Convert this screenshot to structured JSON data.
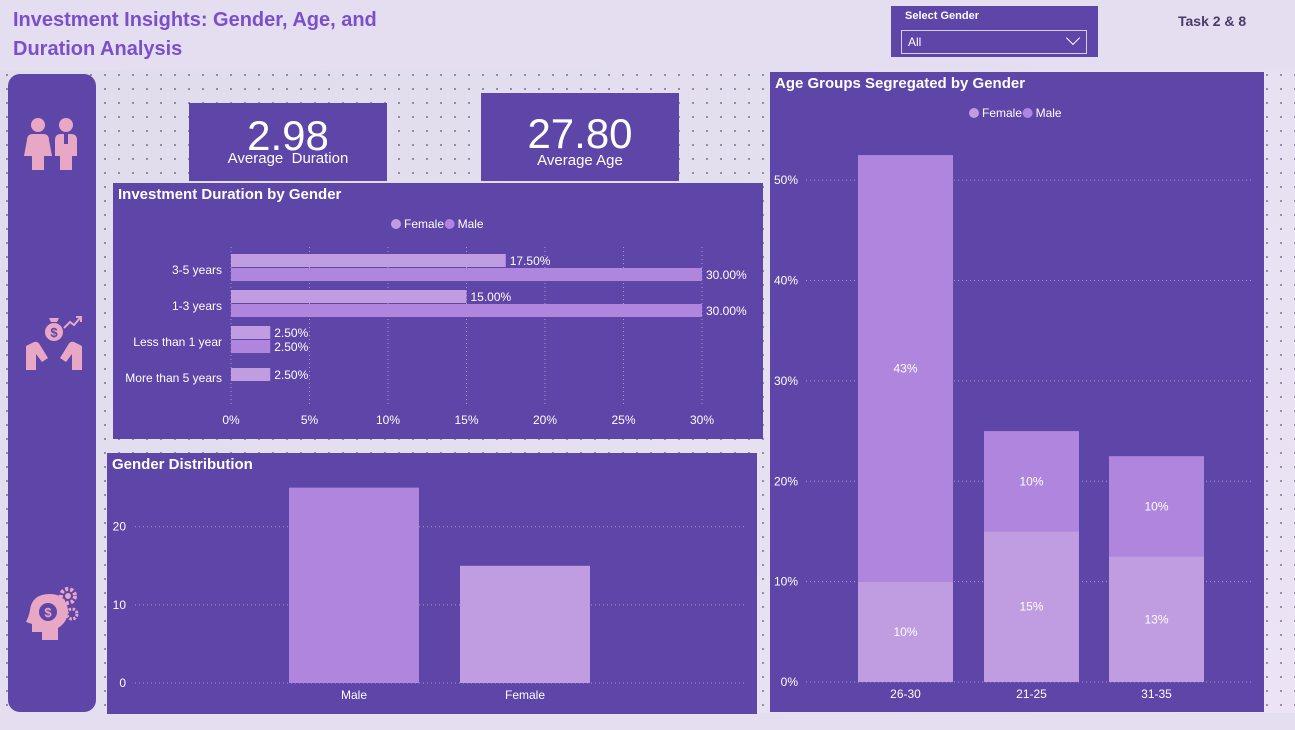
{
  "header": {
    "title": "Investment Insights: Gender, Age, and Duration Analysis",
    "task": "Task 2 & 8"
  },
  "slicer": {
    "label": "Select Gender",
    "value": "All"
  },
  "sidebar": {
    "icons": [
      "people-icon",
      "money-growth-hands-icon",
      "finance-mind-gears-icon"
    ],
    "icon_color": "#e8a7c4"
  },
  "kpis": {
    "duration": {
      "value": "2.98",
      "label": "Average  Duration"
    },
    "age": {
      "value": "27.80",
      "label": "Average Age"
    }
  },
  "colors": {
    "panel": "#5e45a8",
    "female": "#c09de0",
    "male": "#b085de",
    "title": "#7b4fc9"
  },
  "chart_data": [
    {
      "id": "duration",
      "type": "bar",
      "orientation": "horizontal",
      "title": "Investment Duration by Gender",
      "legend": [
        "Female",
        "Male"
      ],
      "legend_position": "top-center",
      "categories": [
        "3-5 years",
        "1-3 years",
        "Less than 1 year",
        "More than 5 years"
      ],
      "series": [
        {
          "name": "Female",
          "values": [
            17.5,
            15.0,
            2.5,
            2.5
          ],
          "labels": [
            "17.50%",
            "15.00%",
            "2.50%",
            "2.50%"
          ]
        },
        {
          "name": "Male",
          "values": [
            30.0,
            30.0,
            2.5,
            null
          ],
          "labels": [
            "30.00%",
            "30.00%",
            "2.50%",
            ""
          ]
        }
      ],
      "xlim": [
        0,
        30
      ],
      "xticks": [
        "0%",
        "5%",
        "10%",
        "15%",
        "20%",
        "25%",
        "30%"
      ],
      "xtick_values": [
        0,
        5,
        10,
        15,
        20,
        25,
        30
      ],
      "grid": true
    },
    {
      "id": "gender",
      "type": "bar",
      "title": "Gender Distribution",
      "categories": [
        "Male",
        "Female"
      ],
      "values": [
        25,
        15
      ],
      "ylim": [
        0,
        27
      ],
      "yticks": [
        "0",
        "10",
        "20"
      ],
      "ytick_values": [
        0,
        10,
        20
      ],
      "grid": true
    },
    {
      "id": "age",
      "type": "bar",
      "stacked": true,
      "title": "Age Groups Segregated by Gender",
      "legend": [
        "Female",
        "Male"
      ],
      "legend_position": "top-center",
      "categories": [
        "26-30",
        "21-25",
        "31-35"
      ],
      "series": [
        {
          "name": "Female",
          "values": [
            10,
            15,
            12.5
          ],
          "labels": [
            "10%",
            "15%",
            "13%"
          ]
        },
        {
          "name": "Male",
          "values": [
            42.5,
            10,
            10
          ],
          "labels": [
            "43%",
            "10%",
            "10%"
          ]
        }
      ],
      "ylim": [
        0,
        55
      ],
      "yticks": [
        "0%",
        "10%",
        "20%",
        "30%",
        "40%",
        "50%"
      ],
      "ytick_values": [
        0,
        10,
        20,
        30,
        40,
        50
      ],
      "grid": true
    }
  ]
}
